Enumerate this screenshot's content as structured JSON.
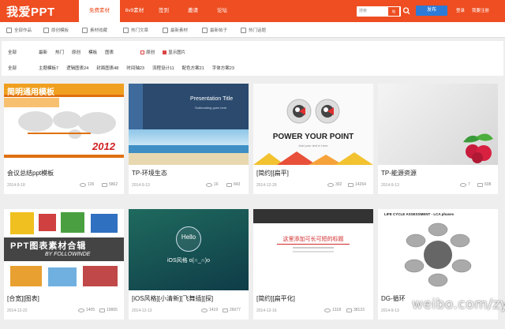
{
  "header": {
    "logo": "我爱PPT",
    "nav": [
      "免费素材",
      "6v9素材",
      "签到",
      "邀请",
      "论坛"
    ],
    "search_placeholder": "搜索",
    "search_btn": "站",
    "publish": "发布",
    "login": "登录",
    "register": "我要注册"
  },
  "subnav": [
    "全部作品",
    "原创模板",
    "素材收藏",
    "热门文章",
    "最新素材",
    "最新帖子",
    "热门话题"
  ],
  "filter": {
    "row1_label": "全部",
    "row1": [
      "最新",
      "热门",
      "原创",
      "模板",
      "图表"
    ],
    "row1_checks": [
      "原创",
      "显示图片"
    ],
    "row2_label": "全部",
    "row2": [
      "主题模板7",
      "逻辑图表24",
      "封面图表48",
      "时间轴23",
      "流程设计11",
      "配色方案21",
      "字体方案23"
    ]
  },
  "cards": [
    {
      "title": "会议总结ppt模板",
      "date": "2014-9-18",
      "views": "126",
      "comments": "5862",
      "thumb_text": "简明通用模板",
      "thumb_year": "2012"
    },
    {
      "title": "TP-环境生态",
      "date": "2014-9-13",
      "views": "16",
      "comments": "843",
      "thumb_text": "Presentation Title",
      "thumb_sub": "Subheading goes here"
    },
    {
      "title": "[简约][扁平]",
      "date": "2014-12-29",
      "views": "302",
      "comments": "14264",
      "thumb_text": "POWER YOUR POINT",
      "thumb_sub": "Add your text in here"
    },
    {
      "title": "TP-能源资源",
      "date": "2014-9-13",
      "views": "7",
      "comments": "608"
    },
    {
      "title": "[合宽][图表]",
      "date": "2014-12-22",
      "views": "1405",
      "comments": "19865",
      "thumb_text": "PPT图表素材合辑",
      "thumb_sub": "BY FOLLOWINDE"
    },
    {
      "title": "[iOS风格][小清新][飞舞插][探]",
      "date": "2014-12-13",
      "views": "1419",
      "comments": "26077",
      "thumb_text": "Hello",
      "thumb_sub": "iOS风格 o(∩_∩)o"
    },
    {
      "title": "[简约][扁平化]",
      "date": "2014-12-16",
      "views": "1318",
      "comments": "38123",
      "thumb_text": "这里添加可长可短的标题"
    },
    {
      "title": "DG-循环",
      "date": "2014-9-13",
      "views": "",
      "comments": "",
      "thumb_text": "LIFE CYCLE ASSESSMENT - LCA phases"
    }
  ],
  "watermark": "weibo.com/zygu"
}
